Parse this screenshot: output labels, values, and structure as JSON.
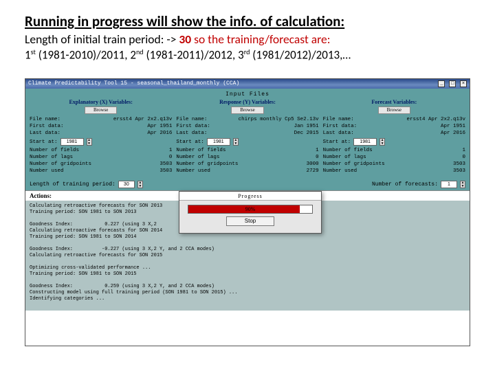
{
  "header": {
    "title": "Running in progress will show the info. of calculation:",
    "sub1_a": "Length of initial train period: ->",
    "sub1_b": "30",
    "sub1_c": "so the training/forecast are:",
    "sub2": "1st (1981-2010)/2011, 2nd (1981-2011)/2012, 3rd (1981/2012)/2013,…"
  },
  "app": {
    "window_title": "Climate Predictability Tool 15 - seasonal_thailand_monthly (CCA)",
    "input_files": "Input Files",
    "browse": "Browse"
  },
  "cols": [
    {
      "title": "Explanatory (X) Variables:",
      "file": "ersst4 Apr 2x2.q13v",
      "first": "Apr 1951",
      "last": "Apr 2016",
      "start": "1981",
      "fields": "1",
      "lags": "0",
      "gridpoints": "3503",
      "used": "3503"
    },
    {
      "title": "Response (Y) Variables:",
      "file": "chirps monthly Cp5 Se2.13v",
      "first": "Jan 1951",
      "last": "Dec 2015",
      "start": "1981",
      "fields": "1",
      "lags": "0",
      "gridpoints": "3000",
      "used": "2729"
    },
    {
      "title": "Forecast Variables:",
      "file": "ersst4 Apr 2x2.q13v",
      "first": "Apr 1951",
      "last": "Apr 2016",
      "start": "1981",
      "fields": "1",
      "lags": "0",
      "gridpoints": "3503",
      "used": "3503"
    }
  ],
  "labels": {
    "file": "File name:",
    "first": "First data:",
    "last": "Last data:",
    "startat": "Start at:",
    "nfields": "Number of fields",
    "nlags": "Number of lags",
    "ngp": "Number of gridpoints",
    "nused": "Number used",
    "ltrain": "Length of training period:",
    "ltrain_val": "30",
    "nfc": "Number of forecasts:",
    "nfc_val": "1",
    "actions": "Actions:"
  },
  "progress": {
    "title": "Progress",
    "pct": "90%",
    "pct_w": "90%",
    "stop": "Stop"
  },
  "output": "Calculating retroactive forecasts for SON 2013\nTraining period: SON 1981 to SON 2013\n\nGoodness Index:           0.227 (using 3 X,2\nCalculating retroactive forecasts for SON 2014\nTraining period: SON 1981 to SON 2014\n\nGoodness Index:          -0.227 (using 3 X,2 Y, and 2 CCA modes)\nCalculating retroactive forecasts for SON 2015\n\nOptimizing cross-validated performance ...\nTraining period: SON 1981 to SON 2015\n\nGoodness Index:           0.259 (using 3 X,2 Y, and 2 CCA modes)\nConstructing model using full training period (SON 1981 to SON 2015) ...\nIdentifying categories ..."
}
